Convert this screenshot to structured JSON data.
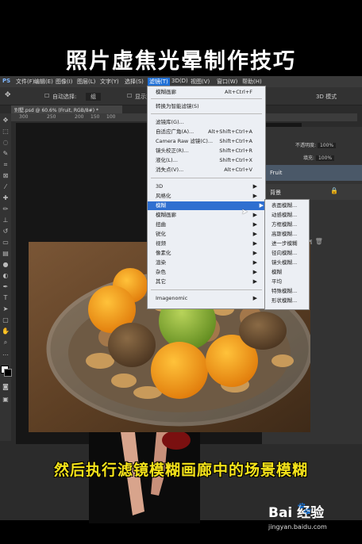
{
  "title": "照片虚焦光晕制作技巧",
  "menubar": {
    "items": [
      "PS",
      "文件(F)",
      "编辑(E)",
      "图像(I)",
      "图层(L)",
      "文字(Y)",
      "选择(S)",
      "滤镜(T)",
      "3D(D)",
      "视图(V)",
      "窗口(W)",
      "帮助(H)"
    ]
  },
  "optbar": {
    "auto_select": "自动选择:",
    "group": "组",
    "show_transform": "显示变",
    "mode3d": "3D 模式"
  },
  "document_tab": "别墅.psd @ 60.6% (Fruit, RGB/8#) *",
  "ruler_ticks": [
    "300",
    "250",
    "200",
    "150",
    "100"
  ],
  "layers": {
    "opacity_label": "不透明度:",
    "opacity_value": "100%",
    "fill_label": "填充:",
    "fill_value": "100%",
    "layer1": "Fruit",
    "layer2": "背景"
  },
  "filter_menu": {
    "last_filter": "模糊画廊",
    "last_filter_shortcut": "Alt+Ctrl+F",
    "smart": "转换为智能滤镜(S)",
    "gallery": "滤镜库(G)...",
    "wide_angle": "自适应广角(A)...",
    "wide_angle_shortcut": "Alt+Shift+Ctrl+A",
    "camera_raw": "Camera Raw 滤镜(C)...",
    "camera_raw_shortcut": "Shift+Ctrl+A",
    "lens": "镜头校正(R)...",
    "lens_shortcut": "Shift+Ctrl+R",
    "liquify": "液化(L)...",
    "liquify_shortcut": "Shift+Ctrl+X",
    "vanish": "消失点(V)...",
    "vanish_shortcut": "Alt+Ctrl+V",
    "items": [
      "3D",
      "风格化",
      "模糊",
      "模糊画廊",
      "扭曲",
      "锐化",
      "视频",
      "像素化",
      "渲染",
      "杂色",
      "其它"
    ],
    "imagenomic": "Imagenomic"
  },
  "blur_submenu": [
    "表面模糊...",
    "动感模糊...",
    "方框模糊...",
    "高斯模糊...",
    "进一步模糊",
    "径向模糊...",
    "镜头模糊...",
    "模糊",
    "平均",
    "特殊模糊...",
    "形状模糊..."
  ],
  "subtitle": "然后执行滤镜模糊画廊中的场景模糊",
  "watermark": {
    "brand": "Bai  经验",
    "url": "jingyan.baidu.com"
  },
  "colors": {
    "highlight": "#2f6fd0",
    "subtitle": "#f5e31a",
    "menu_bg": "#eceff4"
  }
}
